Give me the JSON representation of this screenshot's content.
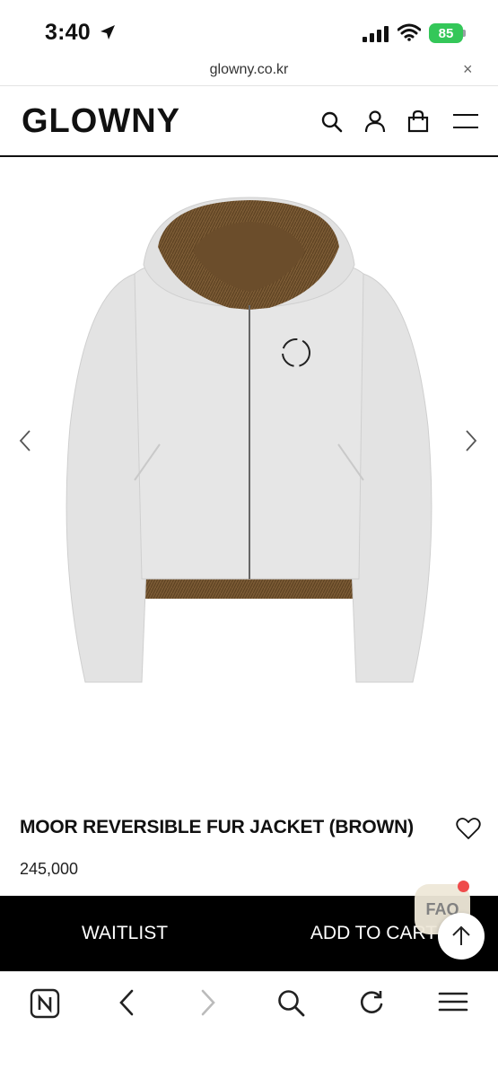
{
  "status_bar": {
    "time": "3:40",
    "battery": "85"
  },
  "browser": {
    "url": "glowny.co.kr",
    "close_symbol": "×"
  },
  "header": {
    "logo": "GLOWNY"
  },
  "icons": {
    "location": "location-arrow-icon",
    "signal": "cellular-signal-icon",
    "wifi": "wifi-icon",
    "search": "search-icon",
    "account": "user-icon",
    "bag": "shopping-bag-icon",
    "menu": "hamburger-menu-icon",
    "prev": "chevron-left-icon",
    "next": "chevron-right-icon",
    "wishlist": "heart-icon",
    "top": "arrow-up-icon"
  },
  "product": {
    "title": "MOOR REVERSIBLE FUR JACKET (BROWN)",
    "price": "245,000",
    "image_alt": "product-photo"
  },
  "cta": {
    "waitlist": "WAITLIST",
    "add_to_cart": "ADD TO CART"
  },
  "floating": {
    "faq": "FAQ"
  },
  "colors": {
    "cta_bg": "#000000",
    "battery": "#34c759",
    "faq_dot": "#ef4b4b",
    "jacket": "#e4e4e4",
    "fur": "#7a5a34"
  }
}
